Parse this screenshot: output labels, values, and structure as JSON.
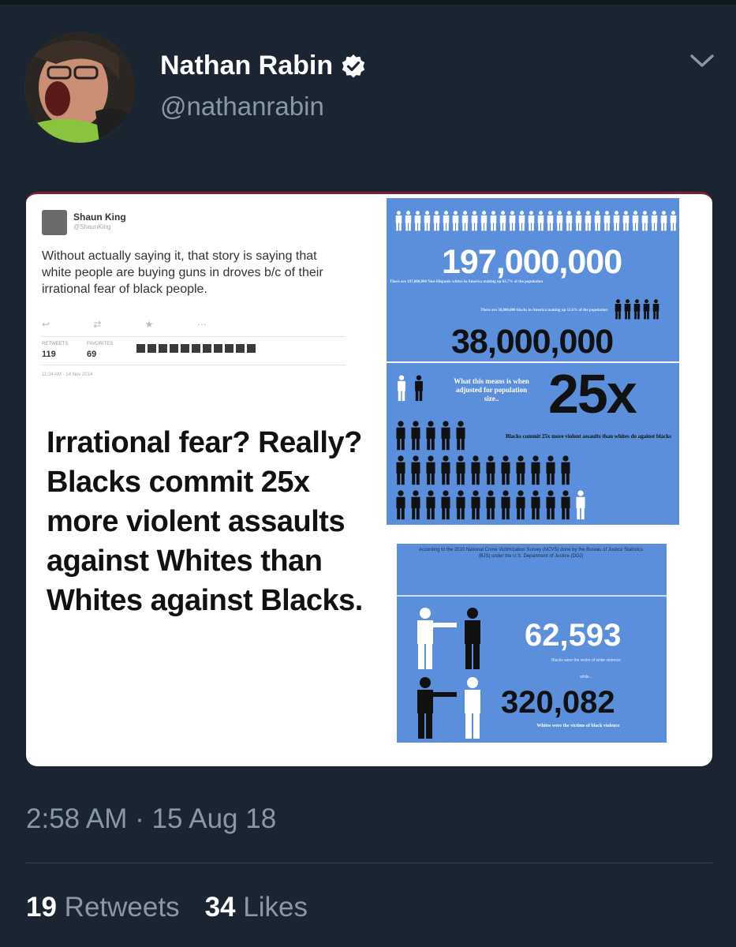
{
  "author": {
    "display_name": "Nathan Rabin",
    "handle": "@nathanrabin",
    "verified": true
  },
  "embedded_tweet": {
    "author_name": "Shaun King",
    "author_handle": "@ShaunKing",
    "text": "Without actually saying it, that story is saying that white people are buying guns in droves b/c of their irrational fear of black people.",
    "retweets_label": "RETWEETS",
    "retweets": "119",
    "favorites_label": "FAVORITES",
    "favorites": "69",
    "date": "11:34 AM - 14 Nov 2014"
  },
  "meme_text": "Irrational fear? Really? Blacks commit 25x more violent assaults against Whites than Whites against Blacks.",
  "infographic": {
    "number_1": "197,000,000",
    "note_1": "There are 197,000,000 Non-Hispanic whites in America making up 63.7% of the population",
    "note_2": "There are 38,000,000 blacks in America making up 12.6% of the population",
    "number_2": "38,000,000",
    "means": "What this means is when adjusted for population size..",
    "multiplier": "25x",
    "blacks_commit": "Blacks commit 25x more violent assaults than whites do against blacks",
    "ncvs": "According to the 2010 National Crime Victimization Survey (NCVS) done by the Bureau of Justice Statistics (BJS) under the U.S. Department of Justice (DOJ)",
    "number_3": "62,593",
    "caption_3": "Blacks were the victim of white violence",
    "while": "while...",
    "number_4": "320,082",
    "caption_4": "Whites were the victims of black violence"
  },
  "timestamp": "2:58 AM · 15 Aug 18",
  "stats": {
    "retweets_count": "19",
    "retweets_label": "Retweets",
    "likes_count": "34",
    "likes_label": "Likes"
  },
  "colors": {
    "background": "#1b2532",
    "secondary_text": "#8899a6",
    "infographic_blue": "#5b8fdb"
  },
  "icons": [
    "verified-badge-icon",
    "chevron-down-icon"
  ]
}
